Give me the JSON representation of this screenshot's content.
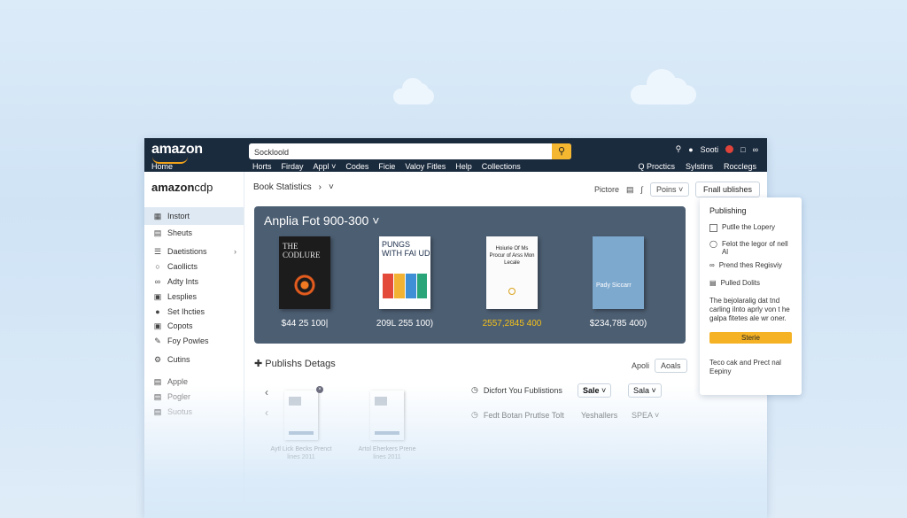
{
  "background": {
    "colors": {
      "sky": "#dcebf8",
      "accent": "#f5b224",
      "header": "#1b2b3e"
    }
  },
  "header": {
    "logo": "amazon",
    "home": "Home",
    "search_value": "Sockloold",
    "right_label": "Sooti",
    "nav": [
      "Horts",
      "Firday",
      "Appl",
      "Codes",
      "Ficie",
      "Valoy Fitles",
      "Help",
      "Collections"
    ],
    "nav_right": [
      "Q Proctics",
      "Sylstins",
      "Rocclegs"
    ]
  },
  "sidebar": {
    "brand_prefix": "amazon",
    "brand_suffix": "cdp",
    "items": [
      {
        "label": "Instort",
        "icon": "grid-icon",
        "active": true
      },
      {
        "label": "Sheuts",
        "icon": "doc-icon"
      },
      {
        "label": "Daetistions",
        "icon": "list-icon",
        "has_chevron": true
      },
      {
        "label": "Caollicts",
        "icon": "chat-icon"
      },
      {
        "label": "Adty Ints",
        "icon": "chart-icon"
      },
      {
        "label": "Lesplies",
        "icon": "stack-icon"
      },
      {
        "label": "Set Ihcties",
        "icon": "person-icon"
      },
      {
        "label": "Copots",
        "icon": "cart-icon"
      },
      {
        "label": "Foy Powles",
        "icon": "pen-icon"
      },
      {
        "label": "Cutins",
        "icon": "gear-icon"
      },
      {
        "label": "Apple",
        "icon": "doc-icon"
      },
      {
        "label": "Pogler",
        "icon": "doc-icon"
      },
      {
        "label": "Suotus",
        "icon": "doc-icon"
      }
    ]
  },
  "toolbar": {
    "breadcrumb": "Book Statistics",
    "right_label": "Pictore",
    "select_label": "Poins",
    "final_button": "Fnall ublishes"
  },
  "hero": {
    "title": "Anplia Fot 900-300",
    "books": [
      {
        "title": "THE CODLURE",
        "price": "$44 25 100|"
      },
      {
        "title": "PUNGS WITH FAI UD",
        "price": "209L 255 100)"
      },
      {
        "title": "Hoiurie Of Ms Procur of Arss Mon Lecale",
        "price": "2557,2845 400"
      },
      {
        "title": "Pady Siccarr",
        "price": "$234,785 400)"
      }
    ]
  },
  "publishing_details": {
    "title": "Publishs Detags",
    "right_a": "Apoli",
    "right_b": "Aoals",
    "thumbs": [
      {
        "caption": "Aytl Lick Becks Prenct lines 2011"
      },
      {
        "caption": "Artol Eherkers Prene lines 2011"
      }
    ],
    "setting1": {
      "label": "Dicfort You Fublistions",
      "select_a": "Sale",
      "select_b": "Sala"
    },
    "setting2": {
      "label": "Fedt Botan Prutlse Tolt",
      "value_a": "Yeshallers",
      "value_b": "SPEA"
    }
  },
  "panel": {
    "title": "Publishing",
    "items": [
      "Putlle the Lopery",
      "Felot the legor of nell Al",
      "Prend thes Regisviy",
      "Pulled Dolits"
    ],
    "paragraph": "The bejolaralig dat tnd carling ilnto aprly von t he galpa fitetes ale wr oner.",
    "button": "Sterie",
    "footer": "Teco cak and Prect nal Eepiny"
  }
}
